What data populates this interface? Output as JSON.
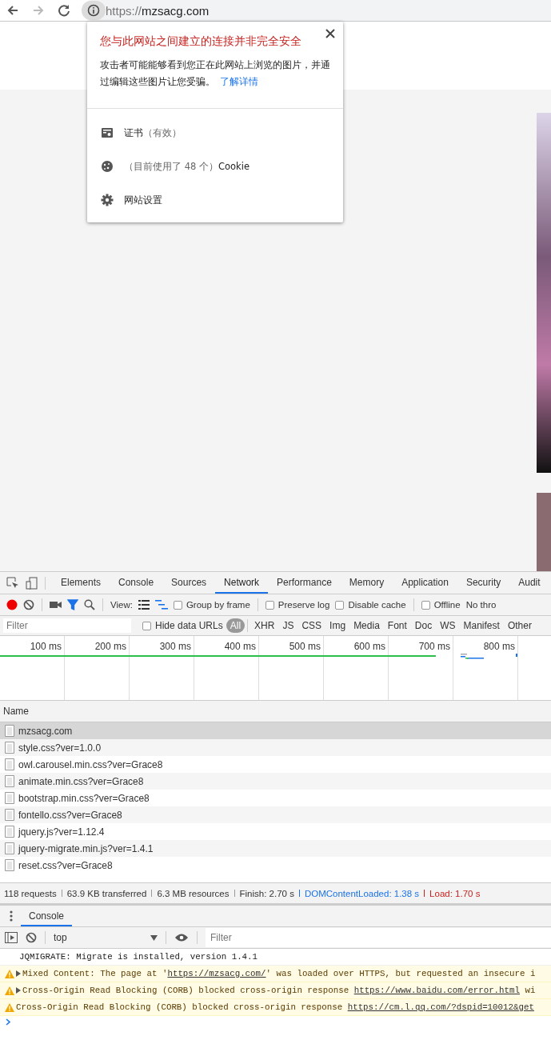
{
  "browser": {
    "back_enabled": true,
    "forward_enabled": false,
    "url_scheme": "https://",
    "url_host": "mzsacg.com"
  },
  "site_info": {
    "title": "您与此网站之间建立的连接并非完全安全",
    "message": "攻击者可能能够看到您正在此网站上浏览的图片，并通过编辑这些图片让您受骗。",
    "link": "了解详情",
    "items": [
      {
        "kind": "certificate",
        "parts": [
          {
            "text": "证书",
            "muted": false
          },
          {
            "text": "（有效）",
            "muted": true
          }
        ]
      },
      {
        "kind": "cookie",
        "parts": [
          {
            "text": "（目前使用了 48 个）",
            "muted": true
          },
          {
            "text": "Cookie",
            "muted": false
          }
        ]
      },
      {
        "kind": "settings",
        "parts": [
          {
            "text": "网站设置",
            "muted": false
          }
        ]
      }
    ]
  },
  "devtools": {
    "tabs": [
      {
        "label": "Elements",
        "selected": false
      },
      {
        "label": "Console",
        "selected": false
      },
      {
        "label": "Sources",
        "selected": false
      },
      {
        "label": "Network",
        "selected": true
      },
      {
        "label": "Performance",
        "selected": false
      },
      {
        "label": "Memory",
        "selected": false
      },
      {
        "label": "Application",
        "selected": false
      },
      {
        "label": "Security",
        "selected": false
      },
      {
        "label": "Audit",
        "selected": false
      }
    ],
    "recording": true,
    "filter_on": true,
    "view_label": "View:",
    "large_rows": false,
    "options": [
      {
        "label": "Group by frame",
        "checked": false
      },
      {
        "label": "Preserve log",
        "checked": false
      },
      {
        "label": "Disable cache",
        "checked": false
      },
      {
        "label": "Offline",
        "checked": false
      }
    ],
    "throttling": "No thro",
    "filter": {
      "placeholder": "Filter",
      "hide_data_urls": {
        "label": "Hide data URLs",
        "checked": false
      }
    },
    "types": [
      {
        "label": "All",
        "selected": true
      },
      {
        "label": "XHR",
        "selected": false
      },
      {
        "label": "JS",
        "selected": false
      },
      {
        "label": "CSS",
        "selected": false
      },
      {
        "label": "Img",
        "selected": false
      },
      {
        "label": "Media",
        "selected": false
      },
      {
        "label": "Font",
        "selected": false
      },
      {
        "label": "Doc",
        "selected": false
      },
      {
        "label": "WS",
        "selected": false
      },
      {
        "label": "Manifest",
        "selected": false
      },
      {
        "label": "Other",
        "selected": false
      }
    ],
    "timeline_ticks": [
      "100 ms",
      "200 ms",
      "300 ms",
      "400 ms",
      "500 ms",
      "600 ms",
      "700 ms",
      "800 ms"
    ],
    "name_column": "Name",
    "requests": [
      {
        "name": "mzsacg.com",
        "selected": true
      },
      {
        "name": "style.css?ver=1.0.0",
        "selected": false
      },
      {
        "name": "owl.carousel.min.css?ver=Grace8",
        "selected": false
      },
      {
        "name": "animate.min.css?ver=Grace8",
        "selected": false
      },
      {
        "name": "bootstrap.min.css?ver=Grace8",
        "selected": false
      },
      {
        "name": "fontello.css?ver=Grace8",
        "selected": false
      },
      {
        "name": "jquery.js?ver=1.12.4",
        "selected": false
      },
      {
        "name": "jquery-migrate.min.js?ver=1.4.1",
        "selected": false
      },
      {
        "name": "reset.css?ver=Grace8",
        "selected": false
      }
    ],
    "summary": [
      {
        "text": "118 requests",
        "color": "#333333"
      },
      {
        "text": "63.9 KB transferred",
        "color": "#333333"
      },
      {
        "text": "6.3 MB resources",
        "color": "#333333"
      },
      {
        "text": "Finish: 2.70 s",
        "color": "#333333"
      },
      {
        "text": "DOMContentLoaded: 1.38 s",
        "color": "#1a73e8"
      },
      {
        "text": "Load: 1.70 s",
        "color": "#c5221f"
      }
    ]
  },
  "console": {
    "drawer_tab": {
      "label": "Console",
      "selected": true
    },
    "context": "top",
    "filter_placeholder": "Filter",
    "messages": [
      {
        "kind": "log",
        "expandable": false,
        "parts": [
          {
            "text": "JQMIGRATE: Migrate is installed, version 1.4.1",
            "link": false
          }
        ]
      },
      {
        "kind": "warning",
        "expandable": true,
        "parts": [
          {
            "text": "Mixed Content: The page at '",
            "link": false
          },
          {
            "text": "https://mzsacg.com/",
            "link": true
          },
          {
            "text": "' was loaded over HTTPS, but requested an insecure i",
            "link": false
          }
        ]
      },
      {
        "kind": "warning",
        "expandable": true,
        "parts": [
          {
            "text": "Cross-Origin Read Blocking (CORB) blocked cross-origin response ",
            "link": false
          },
          {
            "text": "https://www.baidu.com/error.html",
            "link": true
          },
          {
            "text": " wi",
            "link": false
          }
        ]
      },
      {
        "kind": "warning",
        "expandable": false,
        "parts": [
          {
            "text": "Cross-Origin Read Blocking (CORB) blocked cross-origin response ",
            "link": false
          },
          {
            "text": "https://cm.l.qq.com/?dspid=10012&get",
            "link": true
          }
        ]
      }
    ]
  }
}
